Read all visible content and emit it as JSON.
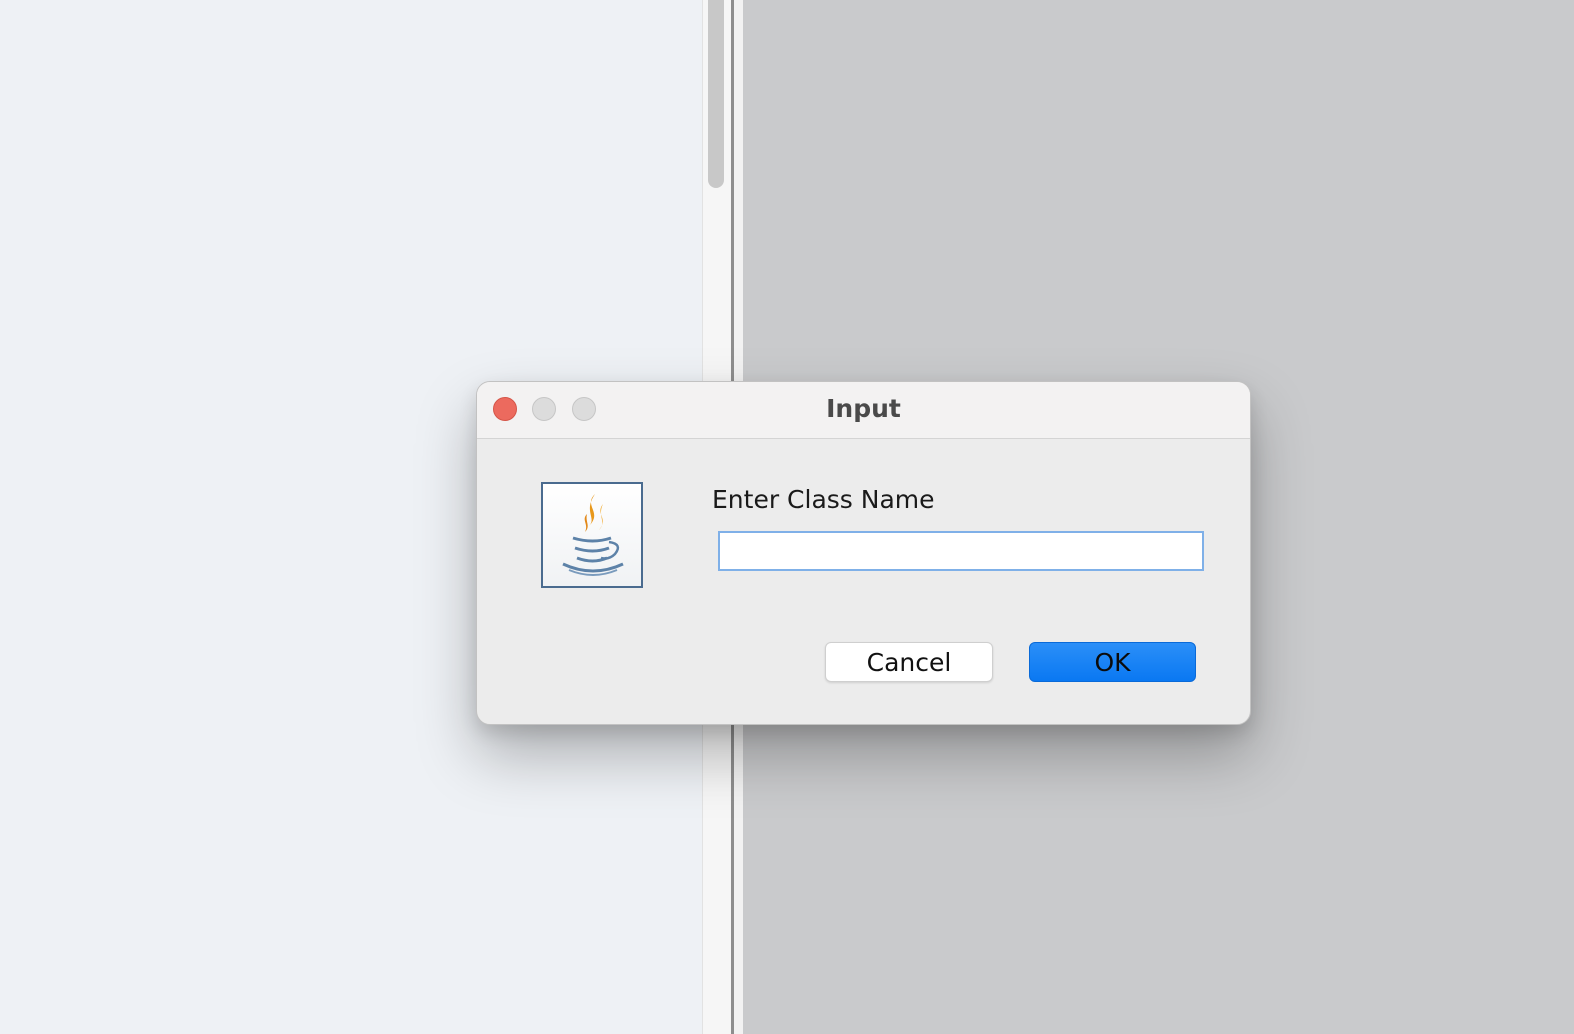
{
  "dialog": {
    "title": "Input",
    "prompt": "Enter Class Name",
    "input_value": "",
    "input_placeholder": "",
    "cancel_label": "Cancel",
    "ok_label": "OK",
    "icon": "java-coffee-cup-icon"
  },
  "colors": {
    "close_button": "#ec6a5e",
    "ok_button": "#0a78f2",
    "input_focus_border": "#7fb0e8",
    "left_pane": "#eef1f5",
    "right_pane": "#c9cacc"
  }
}
